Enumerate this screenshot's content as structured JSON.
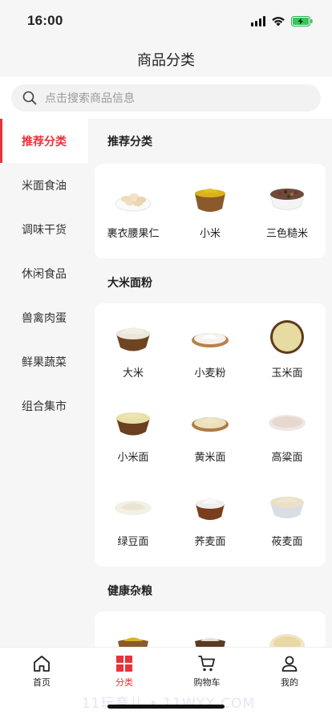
{
  "status_bar": {
    "time": "16:00"
  },
  "header": {
    "title": "商品分类"
  },
  "search": {
    "placeholder": "点击搜索商品信息"
  },
  "sidebar": {
    "items": [
      {
        "label": "推荐分类",
        "active": true
      },
      {
        "label": "米面食油"
      },
      {
        "label": "调味干货"
      },
      {
        "label": "休闲食品"
      },
      {
        "label": "兽禽肉蛋"
      },
      {
        "label": "鲜果蔬菜"
      },
      {
        "label": "组合集市"
      }
    ]
  },
  "sections": [
    {
      "title": "推荐分类",
      "items": [
        {
          "label": "裹衣腰果仁",
          "icon": "cashew-bowl-icon"
        },
        {
          "label": "小米",
          "icon": "millet-bowl-icon"
        },
        {
          "label": "三色糙米",
          "icon": "brown-rice-bowl-icon"
        }
      ]
    },
    {
      "title": "大米面粉",
      "items": [
        {
          "label": "大米",
          "icon": "rice-bowl-icon"
        },
        {
          "label": "小麦粉",
          "icon": "wheat-flour-plate-icon"
        },
        {
          "label": "玉米面",
          "icon": "corn-flour-bowl-icon"
        },
        {
          "label": "小米面",
          "icon": "millet-flour-bowl-icon"
        },
        {
          "label": "黄米面",
          "icon": "yellow-rice-flour-icon"
        },
        {
          "label": "高粱面",
          "icon": "sorghum-flour-icon"
        },
        {
          "label": "绿豆面",
          "icon": "mung-bean-flour-icon"
        },
        {
          "label": "荞麦面",
          "icon": "buckwheat-flour-bowl-icon"
        },
        {
          "label": "莜麦面",
          "icon": "oat-flour-bowl-icon"
        }
      ]
    },
    {
      "title": "健康杂粮",
      "items": [
        {
          "label": "",
          "icon": "grain-bowl-icon"
        },
        {
          "label": "",
          "icon": "grain-bowl-icon"
        },
        {
          "label": "",
          "icon": "grain-bowl-icon"
        }
      ]
    }
  ],
  "tabbar": {
    "items": [
      {
        "label": "首页",
        "icon": "home-icon"
      },
      {
        "label": "分类",
        "icon": "category-icon",
        "active": true
      },
      {
        "label": "购物车",
        "icon": "cart-icon"
      },
      {
        "label": "我的",
        "icon": "profile-icon"
      }
    ]
  },
  "watermark": "11玩育儿 • 11WYX.COM",
  "colors": {
    "accent": "#e8333a",
    "background": "#f6f6f6",
    "card": "#ffffff"
  }
}
